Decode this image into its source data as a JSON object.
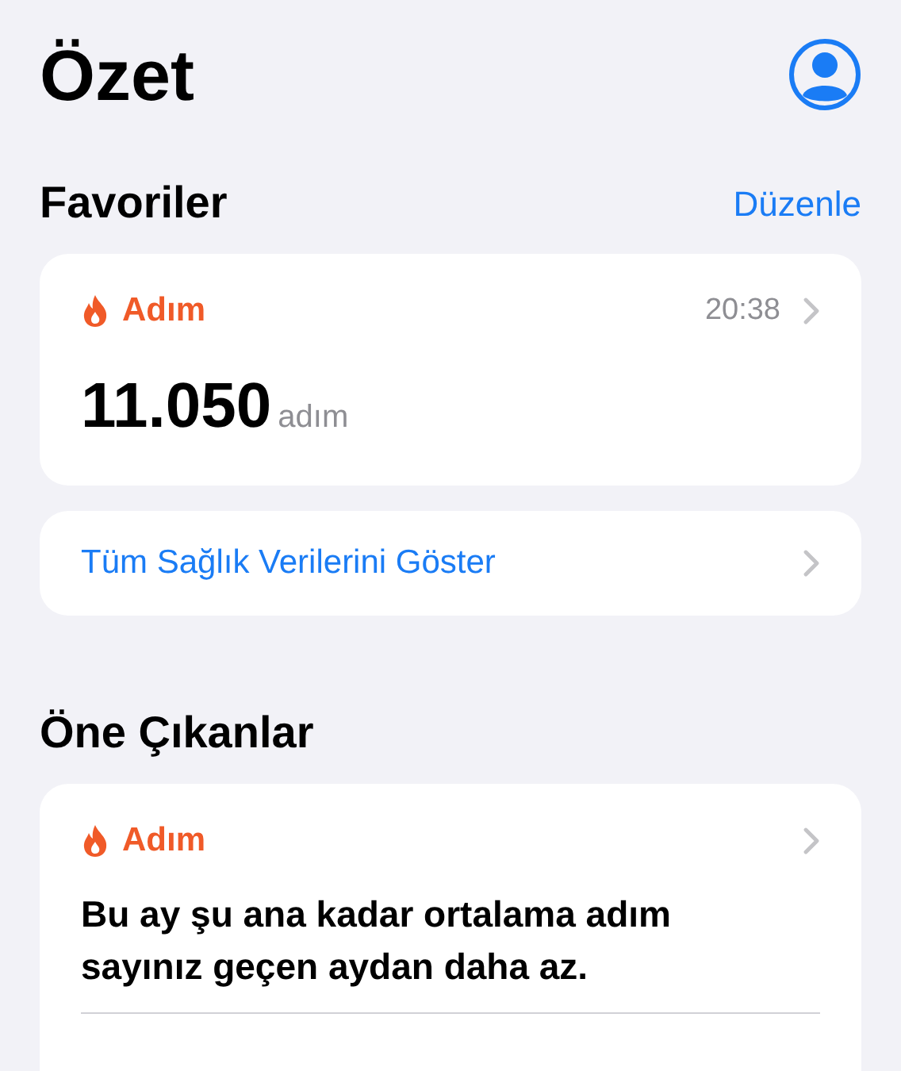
{
  "title": "Özet",
  "favorites": {
    "heading": "Favoriler",
    "edit": "Düzenle",
    "card": {
      "category": "Adım",
      "time": "20:38",
      "value": "11.050",
      "unit": "adım"
    },
    "show_all": "Tüm Sağlık Verilerini Göster"
  },
  "highlights": {
    "heading": "Öne Çıkanlar",
    "card": {
      "category": "Adım",
      "message": "Bu ay şu ana kadar ortalama adım sayınız geçen aydan daha az."
    }
  }
}
